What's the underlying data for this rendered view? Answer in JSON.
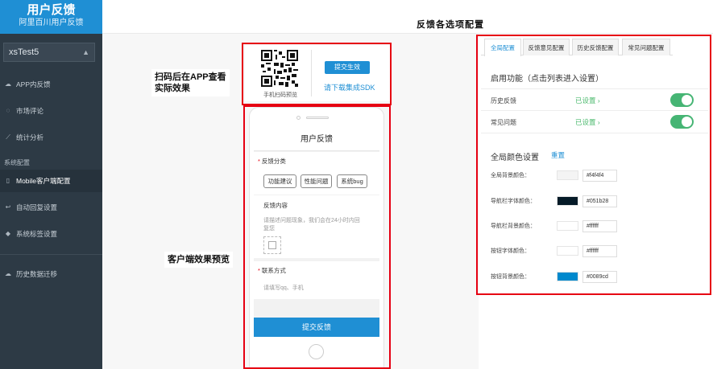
{
  "sidebar": {
    "brand_title": "用户反馈",
    "brand_subtitle": "阿里百川用户反馈",
    "app_selector": "xsTest5",
    "section_label": "系统配置",
    "items": [
      {
        "label": "APP内反馈",
        "icon": "cloud-icon"
      },
      {
        "label": "市场评论",
        "icon": "comment-icon"
      },
      {
        "label": "统计分析",
        "icon": "chart-icon"
      },
      {
        "label": "Mobile客户端配置",
        "icon": "mobile-icon"
      },
      {
        "label": "自动回复设置",
        "icon": "reply-icon"
      },
      {
        "label": "系统标签设置",
        "icon": "tag-icon"
      },
      {
        "label": "历史数据迁移",
        "icon": "cloud-upload-icon"
      }
    ]
  },
  "header": {
    "title": "反馈各选项配置"
  },
  "annotations": {
    "scan_note_line1": "扫码后在APP查看",
    "scan_note_line2": "实际效果",
    "preview_note": "客户端效果预览"
  },
  "qr_panel": {
    "caption": "手机扫码预览",
    "submit_button": "提交生效",
    "sdk_link": "请下载集成SDK"
  },
  "phone_preview": {
    "title": "用户反馈",
    "category_label": "反馈分类",
    "categories": [
      "功能建议",
      "性能问题",
      "系统bug"
    ],
    "content_label": "反馈内容",
    "content_placeholder_line1": "请描述问题现象，我们会在24小时内回",
    "content_placeholder_line2": "复您",
    "contact_label": "联系方式",
    "contact_placeholder": "请填写qq、手机",
    "submit_button": "提交反馈"
  },
  "config": {
    "tabs": [
      "全局配置",
      "反馈意见配置",
      "历史反馈配置",
      "常见问题配置"
    ],
    "feature_title": "启用功能（点击列表进入设置）",
    "features": [
      {
        "label": "历史反馈",
        "status": "已设置",
        "enabled": true
      },
      {
        "label": "常见问题",
        "status": "已设置",
        "enabled": true
      }
    ],
    "color_title": "全局颜色设置",
    "reset_label": "重置",
    "colors": [
      {
        "label": "全局背景颜色：",
        "hex": "#f4f4f4"
      },
      {
        "label": "导航栏字体颜色：",
        "hex": "#051b28"
      },
      {
        "label": "导航栏背景颜色：",
        "hex": "#ffffff"
      },
      {
        "label": "按钮字体颜色：",
        "hex": "#ffffff"
      },
      {
        "label": "按钮背景颜色：",
        "hex": "#0089cd"
      }
    ]
  },
  "theme": {
    "accent": "#1f8fd4",
    "highlight": "#e60012",
    "toggle_on": "#46b574"
  }
}
